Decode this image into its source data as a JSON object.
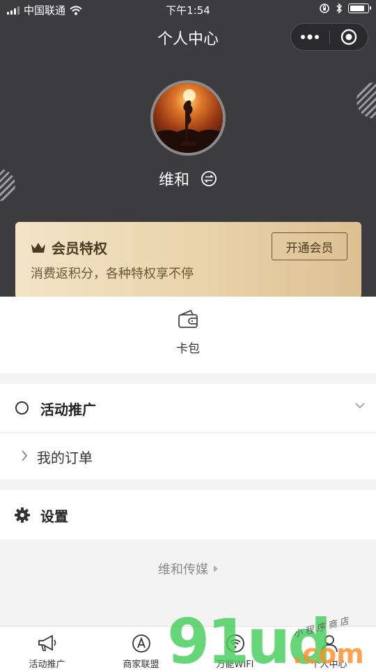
{
  "status_bar": {
    "carrier": "中国联通",
    "time": "下午1:54",
    "battery_level": 0.85
  },
  "nav": {
    "title": "个人中心",
    "more_icon": "more-dots-icon",
    "close_icon": "target-icon"
  },
  "profile": {
    "username": "维和",
    "switch_icon": "switch-icon"
  },
  "member_card": {
    "title": "会员特权",
    "description": "消费返积分，各种特权享不停",
    "button_label": "开通会员",
    "icon": "crown-icon"
  },
  "wallet": {
    "label": "卡包",
    "icon": "wallet-icon"
  },
  "menu": {
    "activity_label": "活动推广",
    "order_label": "我的订单",
    "settings_label": "设置"
  },
  "footer": {
    "brand": "维和传媒"
  },
  "tabbar": [
    {
      "label": "活动推广",
      "icon": "megaphone-icon"
    },
    {
      "label": "商家联盟",
      "icon": "circle-a-icon"
    },
    {
      "label": "万能WIFI",
      "icon": "wifi-icon"
    },
    {
      "label": "个人中心",
      "icon": "person-icon"
    }
  ],
  "watermark": {
    "main": "91ud",
    "suffix": ".com",
    "handwritten": "小程序商店"
  },
  "colors": {
    "header_bg": "#3c3c3e",
    "member_card_gold": "#e9d3aa",
    "member_text_brown": "#4a3a1f",
    "watermark_green": "#46cd5a",
    "watermark_orange": "#ff8c28"
  }
}
